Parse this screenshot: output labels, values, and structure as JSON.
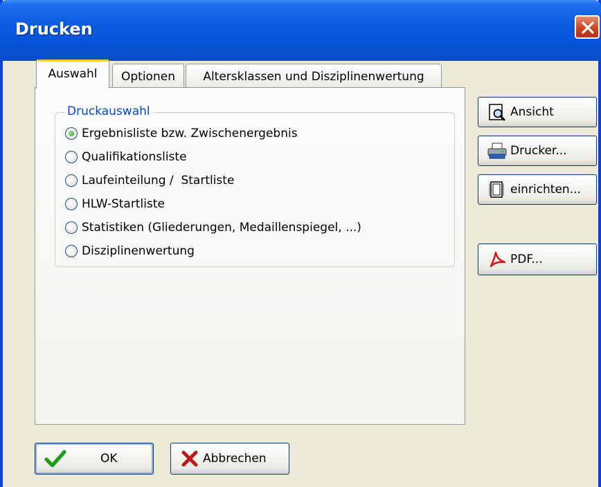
{
  "window": {
    "title": "Drucken"
  },
  "tabs": [
    {
      "label": "Auswahl",
      "active": true
    },
    {
      "label": "Optionen",
      "active": false
    },
    {
      "label": "Altersklassen und Disziplinenwertung",
      "active": false
    }
  ],
  "druckauswahl": {
    "legend": "Druckauswahl",
    "options": [
      {
        "label": "Ergebnisliste bzw. Zwischenergebnis",
        "checked": true
      },
      {
        "label": "Qualifikationsliste",
        "checked": false
      },
      {
        "label": "Laufeinteilung /  Startliste",
        "checked": false
      },
      {
        "label": "HLW-Startliste",
        "checked": false
      },
      {
        "label": "Statistiken (Gliederungen, Medaillenspiegel, ...)",
        "checked": false
      },
      {
        "label": "Disziplinenwertung",
        "checked": false
      }
    ]
  },
  "side_buttons": {
    "ansicht": "Ansicht",
    "drucker": "Drucker...",
    "einrichten": "einrichten...",
    "pdf": "PDF..."
  },
  "footer": {
    "ok": "OK",
    "abbrechen": "Abbrechen"
  },
  "icons": {
    "close": "close-icon",
    "ansicht": "preview-magnifier-icon",
    "drucker": "printer-icon",
    "einrichten": "page-setup-icon",
    "pdf": "acrobat-pdf-icon",
    "ok": "green-checkmark-icon",
    "abbrechen": "red-x-icon"
  },
  "colors": {
    "titlebar": "#0A5BE0",
    "dialog_bg": "#ECE9D8",
    "legend_text": "#0046D5",
    "active_tab_accent": "#FFC83C"
  }
}
